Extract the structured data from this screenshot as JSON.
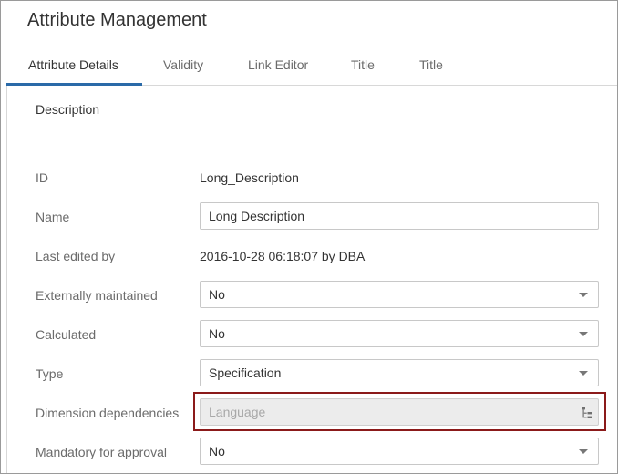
{
  "app": {
    "title": "Attribute Management"
  },
  "tabs": [
    {
      "label": "Attribute Details"
    },
    {
      "label": "Validity"
    },
    {
      "label": "Link Editor"
    },
    {
      "label": "Title"
    },
    {
      "label": "Title"
    }
  ],
  "section": {
    "title": "Description"
  },
  "fields": {
    "id": {
      "label": "ID",
      "value": "Long_Description"
    },
    "name": {
      "label": "Name",
      "value": "Long Description"
    },
    "last_edited": {
      "label": "Last edited by",
      "value": "2016-10-28 06:18:07 by DBA"
    },
    "externally_maintained": {
      "label": "Externally maintained",
      "value": "No"
    },
    "calculated": {
      "label": "Calculated",
      "value": "No"
    },
    "type": {
      "label": "Type",
      "value": "Specification"
    },
    "dimension_dependencies": {
      "label": "Dimension dependencies",
      "placeholder": "Language"
    },
    "mandatory_for_approval": {
      "label": "Mandatory for approval",
      "value": "No"
    }
  },
  "colors": {
    "accent": "#2a6aa8",
    "highlight_border": "#8b1a1a"
  },
  "icons": {
    "dropdown": "chevron-down-icon",
    "tree": "tree-icon"
  }
}
